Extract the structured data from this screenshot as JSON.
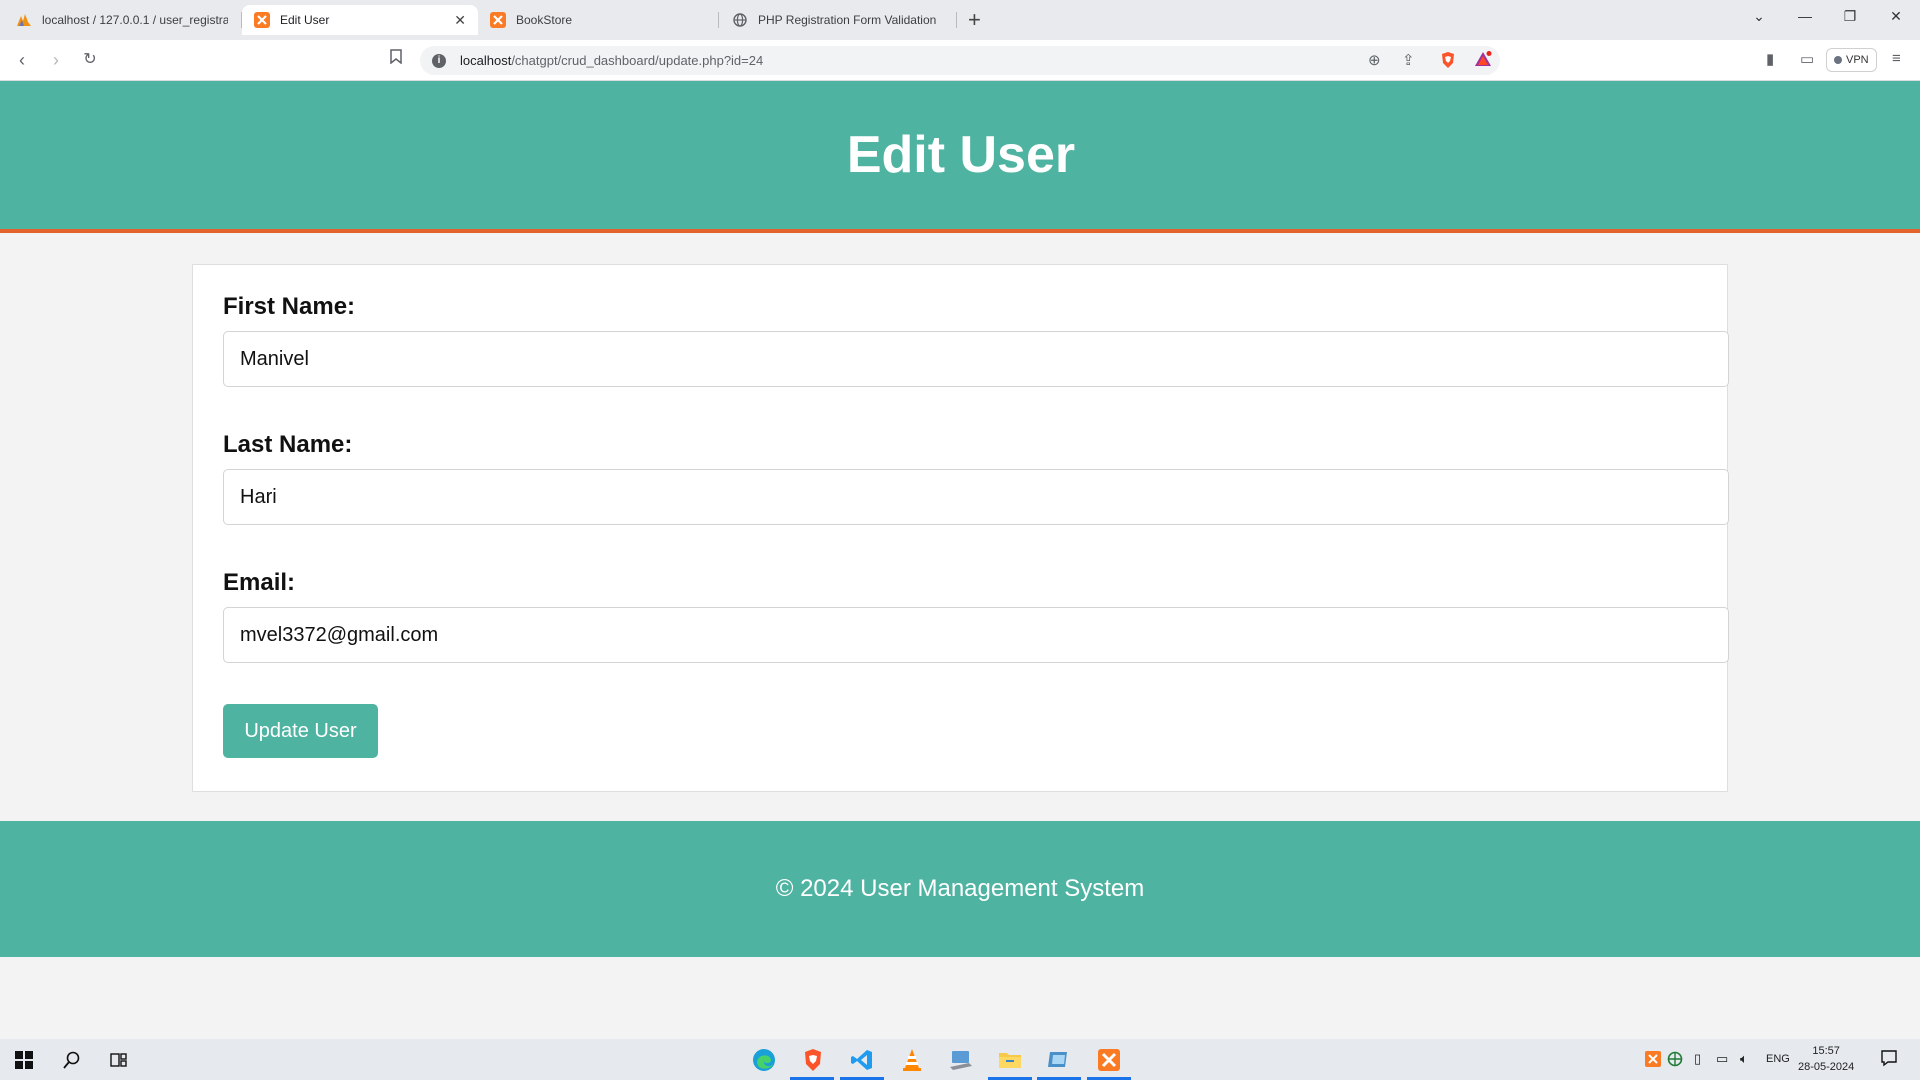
{
  "browser": {
    "tabs": [
      {
        "title": "localhost / 127.0.0.1 / user_registratio",
        "active": false,
        "favicon": "phpmyadmin-icon"
      },
      {
        "title": "Edit User",
        "active": true,
        "favicon": "xampp-icon"
      },
      {
        "title": "BookStore",
        "active": false,
        "favicon": "xampp-icon"
      },
      {
        "title": "PHP Registration Form Validation",
        "active": false,
        "favicon": "globe-icon"
      }
    ],
    "url_host": "localhost",
    "url_path": "/chatgpt/crud_dashboard/update.php?id=24",
    "vpn_label": "VPN"
  },
  "page": {
    "header_title": "Edit User",
    "form": {
      "first_name_label": "First Name:",
      "first_name_value": "Manivel",
      "last_name_label": "Last Name:",
      "last_name_value": "Hari",
      "email_label": "Email:",
      "email_value": "mvel3372@gmail.com",
      "submit_label": "Update User"
    },
    "footer_text": "© 2024 User Management System"
  },
  "taskbar": {
    "language": "ENG",
    "time": "15:57",
    "date": "28-05-2024"
  },
  "colors": {
    "brand": "#4fb3a1",
    "accent_border": "#e4622c"
  }
}
